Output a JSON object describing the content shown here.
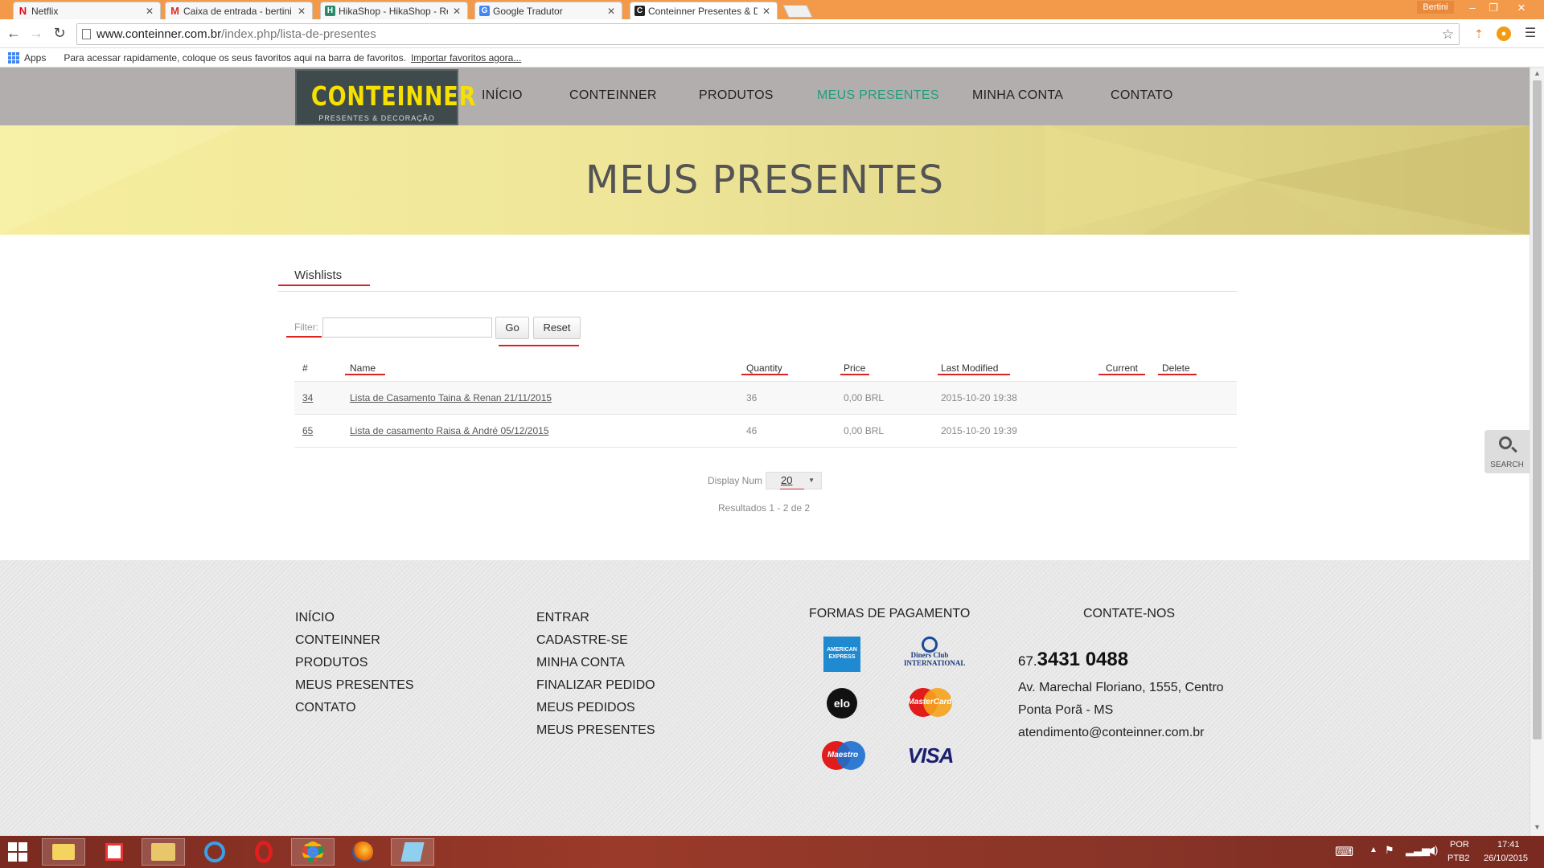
{
  "browser": {
    "tabs": [
      {
        "label": "Netflix",
        "favicon": "N",
        "color": "#e50914"
      },
      {
        "label": "Caixa de entrada - bertini",
        "favicon": "M",
        "color": "#d93025"
      },
      {
        "label": "HikaShop - HikaShop - Re",
        "favicon": "H",
        "color": "#2a8a6a"
      },
      {
        "label": "Google Tradutor",
        "favicon": "G",
        "color": "#4285f4"
      },
      {
        "label": "Conteinner Presentes & D",
        "favicon": "C",
        "color": "#222222"
      }
    ],
    "profile_name": "Bertini",
    "url_host": "www.conteinner.com.br",
    "url_path": "/index.php/lista-de-presentes",
    "bookmarks": {
      "apps_label": "Apps",
      "hint": "Para acessar rapidamente, coloque os seus favoritos aqui na barra de favoritos.",
      "import_link": "Importar favoritos agora..."
    }
  },
  "site": {
    "logo_text": "CONTEINNER",
    "logo_sub": "PRESENTES & DECORAÇÃO",
    "menu": [
      "INÍCIO",
      "CONTEINNER",
      "PRODUTOS",
      "MEUS PRESENTES",
      "MINHA CONTA",
      "CONTATO"
    ],
    "active_menu": "MEUS PRESENTES",
    "accent": "#1e9e7c",
    "banner_title": "MEUS PRESENTES"
  },
  "wishlists": {
    "tab_label": "Wishlists",
    "filter_label": "Filter:",
    "filter_value": "",
    "go_label": "Go",
    "reset_label": "Reset",
    "headers": {
      "num": "#",
      "name": "Name",
      "quantity": "Quantity",
      "price": "Price",
      "last_modified": "Last Modified",
      "current": "Current",
      "delete": "Delete"
    },
    "rows": [
      {
        "id": "34",
        "name": "Lista de Casamento Taina & Renan 21/11/2015",
        "quantity": "36",
        "price": "0,00 BRL",
        "modified": "2015-10-20 19:38"
      },
      {
        "id": "65",
        "name": "Lista de casamento Raisa & André 05/12/2015",
        "quantity": "46",
        "price": "0,00 BRL",
        "modified": "2015-10-20 19:39"
      }
    ],
    "display_label": "Display Num",
    "display_value": "20",
    "results_text": "Resultados 1 - 2 de 2"
  },
  "search_widget_label": "SEARCH",
  "footer": {
    "col1": [
      "INÍCIO",
      "CONTEINNER",
      "PRODUTOS",
      "MEUS PRESENTES",
      "CONTATO"
    ],
    "col2": [
      "ENTRAR",
      "CADASTRE-SE",
      "MINHA CONTA",
      "FINALIZAR PEDIDO",
      "MEUS PEDIDOS",
      "MEUS PRESENTES"
    ],
    "payment_title": "FORMAS DE PAGAMENTO",
    "cards": [
      "AMERICAN EXPRESS",
      "Diners Club INTERNATIONAL",
      "elo",
      "MasterCard",
      "Maestro",
      "VISA"
    ],
    "contact_title": "CONTATE-NOS",
    "phone_ddd": "67.",
    "phone_number": "3431 0488",
    "address_line1": "Av. Marechal Floriano, 1555, Centro",
    "address_line2": "Ponta Porã - MS",
    "email": "atendimento@conteinner.com.br"
  },
  "taskbar": {
    "language": "POR",
    "layout": "PTB2",
    "time": "17:41",
    "date": "26/10/2015"
  }
}
